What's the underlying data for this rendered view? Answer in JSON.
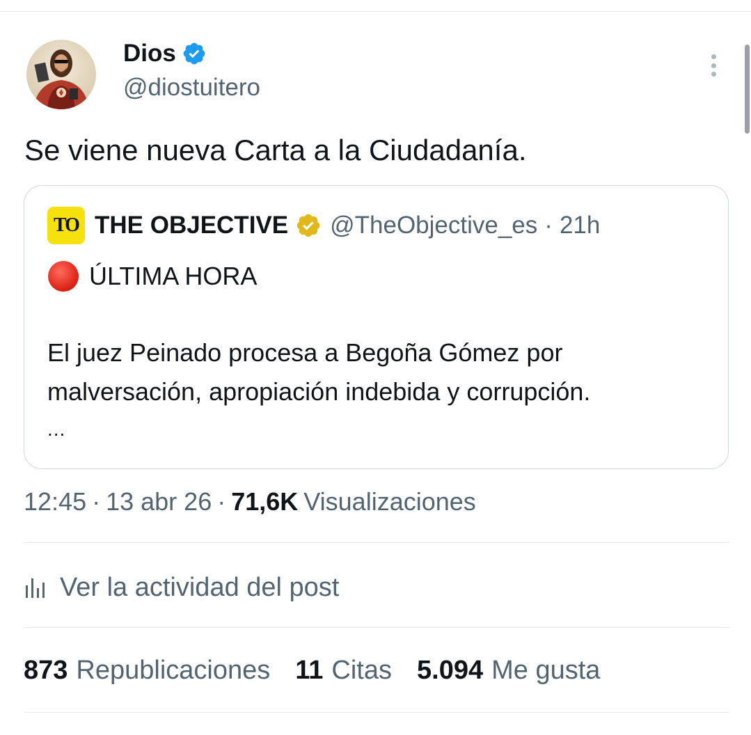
{
  "author": {
    "display_name": "Dios",
    "handle": "@diostuitero",
    "verified": true,
    "verified_color": "#1d9bf0"
  },
  "tweet": {
    "text": "Se viene nueva Carta a la Ciudadanía."
  },
  "quoted": {
    "logo_text": "TO",
    "logo_color": "#f5e10c",
    "name": "THE OBJECTIVE",
    "badge_color": "#e2b719",
    "handle": "@TheObjective_es",
    "separator": "·",
    "time": "21h",
    "breaking_label": "ÚLTIMA HORA",
    "body": "El juez Peinado procesa a Begoña Gómez por malversación, apropiación indebida y corrupción.",
    "ellipsis": "..."
  },
  "meta": {
    "time": "12:45",
    "sep1": "·",
    "date": "13 abr 26",
    "sep2": "·",
    "views_count": "71,6K",
    "views_label": "Visualizaciones"
  },
  "activity": {
    "label": "Ver la actividad del post",
    "icon": "bar-chart-icon"
  },
  "stats": {
    "reposts_count": "873",
    "reposts_label": "Republicaciones",
    "quotes_count": "11",
    "quotes_label": "Citas",
    "likes_count": "5.094",
    "likes_label": "Me gusta"
  }
}
